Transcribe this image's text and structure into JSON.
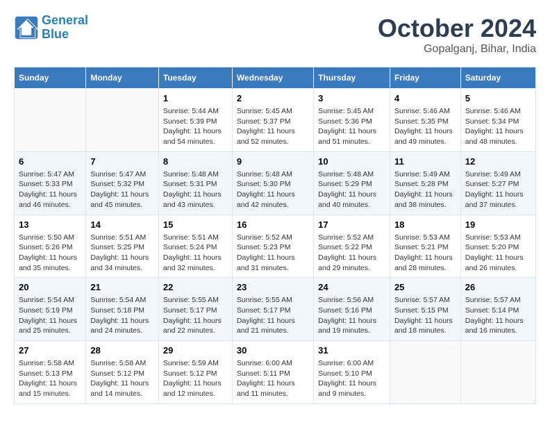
{
  "logo": {
    "line1": "General",
    "line2": "Blue"
  },
  "title": "October 2024",
  "subtitle": "Gopalganj, Bihar, India",
  "header": {
    "days": [
      "Sunday",
      "Monday",
      "Tuesday",
      "Wednesday",
      "Thursday",
      "Friday",
      "Saturday"
    ]
  },
  "weeks": [
    [
      {
        "day": "",
        "info": ""
      },
      {
        "day": "",
        "info": ""
      },
      {
        "day": "1",
        "sunrise": "5:44 AM",
        "sunset": "5:39 PM",
        "daylight": "11 hours and 54 minutes."
      },
      {
        "day": "2",
        "sunrise": "5:45 AM",
        "sunset": "5:37 PM",
        "daylight": "11 hours and 52 minutes."
      },
      {
        "day": "3",
        "sunrise": "5:45 AM",
        "sunset": "5:36 PM",
        "daylight": "11 hours and 51 minutes."
      },
      {
        "day": "4",
        "sunrise": "5:46 AM",
        "sunset": "5:35 PM",
        "daylight": "11 hours and 49 minutes."
      },
      {
        "day": "5",
        "sunrise": "5:46 AM",
        "sunset": "5:34 PM",
        "daylight": "11 hours and 48 minutes."
      }
    ],
    [
      {
        "day": "6",
        "sunrise": "5:47 AM",
        "sunset": "5:33 PM",
        "daylight": "11 hours and 46 minutes."
      },
      {
        "day": "7",
        "sunrise": "5:47 AM",
        "sunset": "5:32 PM",
        "daylight": "11 hours and 45 minutes."
      },
      {
        "day": "8",
        "sunrise": "5:48 AM",
        "sunset": "5:31 PM",
        "daylight": "11 hours and 43 minutes."
      },
      {
        "day": "9",
        "sunrise": "5:48 AM",
        "sunset": "5:30 PM",
        "daylight": "11 hours and 42 minutes."
      },
      {
        "day": "10",
        "sunrise": "5:48 AM",
        "sunset": "5:29 PM",
        "daylight": "11 hours and 40 minutes."
      },
      {
        "day": "11",
        "sunrise": "5:49 AM",
        "sunset": "5:28 PM",
        "daylight": "11 hours and 38 minutes."
      },
      {
        "day": "12",
        "sunrise": "5:49 AM",
        "sunset": "5:27 PM",
        "daylight": "11 hours and 37 minutes."
      }
    ],
    [
      {
        "day": "13",
        "sunrise": "5:50 AM",
        "sunset": "5:26 PM",
        "daylight": "11 hours and 35 minutes."
      },
      {
        "day": "14",
        "sunrise": "5:51 AM",
        "sunset": "5:25 PM",
        "daylight": "11 hours and 34 minutes."
      },
      {
        "day": "15",
        "sunrise": "5:51 AM",
        "sunset": "5:24 PM",
        "daylight": "11 hours and 32 minutes."
      },
      {
        "day": "16",
        "sunrise": "5:52 AM",
        "sunset": "5:23 PM",
        "daylight": "11 hours and 31 minutes."
      },
      {
        "day": "17",
        "sunrise": "5:52 AM",
        "sunset": "5:22 PM",
        "daylight": "11 hours and 29 minutes."
      },
      {
        "day": "18",
        "sunrise": "5:53 AM",
        "sunset": "5:21 PM",
        "daylight": "11 hours and 28 minutes."
      },
      {
        "day": "19",
        "sunrise": "5:53 AM",
        "sunset": "5:20 PM",
        "daylight": "11 hours and 26 minutes."
      }
    ],
    [
      {
        "day": "20",
        "sunrise": "5:54 AM",
        "sunset": "5:19 PM",
        "daylight": "11 hours and 25 minutes."
      },
      {
        "day": "21",
        "sunrise": "5:54 AM",
        "sunset": "5:18 PM",
        "daylight": "11 hours and 24 minutes."
      },
      {
        "day": "22",
        "sunrise": "5:55 AM",
        "sunset": "5:17 PM",
        "daylight": "11 hours and 22 minutes."
      },
      {
        "day": "23",
        "sunrise": "5:55 AM",
        "sunset": "5:17 PM",
        "daylight": "11 hours and 21 minutes."
      },
      {
        "day": "24",
        "sunrise": "5:56 AM",
        "sunset": "5:16 PM",
        "daylight": "11 hours and 19 minutes."
      },
      {
        "day": "25",
        "sunrise": "5:57 AM",
        "sunset": "5:15 PM",
        "daylight": "11 hours and 18 minutes."
      },
      {
        "day": "26",
        "sunrise": "5:57 AM",
        "sunset": "5:14 PM",
        "daylight": "11 hours and 16 minutes."
      }
    ],
    [
      {
        "day": "27",
        "sunrise": "5:58 AM",
        "sunset": "5:13 PM",
        "daylight": "11 hours and 15 minutes."
      },
      {
        "day": "28",
        "sunrise": "5:58 AM",
        "sunset": "5:12 PM",
        "daylight": "11 hours and 14 minutes."
      },
      {
        "day": "29",
        "sunrise": "5:59 AM",
        "sunset": "5:12 PM",
        "daylight": "11 hours and 12 minutes."
      },
      {
        "day": "30",
        "sunrise": "6:00 AM",
        "sunset": "5:11 PM",
        "daylight": "11 hours and 11 minutes."
      },
      {
        "day": "31",
        "sunrise": "6:00 AM",
        "sunset": "5:10 PM",
        "daylight": "11 hours and 9 minutes."
      },
      {
        "day": "",
        "info": ""
      },
      {
        "day": "",
        "info": ""
      }
    ]
  ]
}
